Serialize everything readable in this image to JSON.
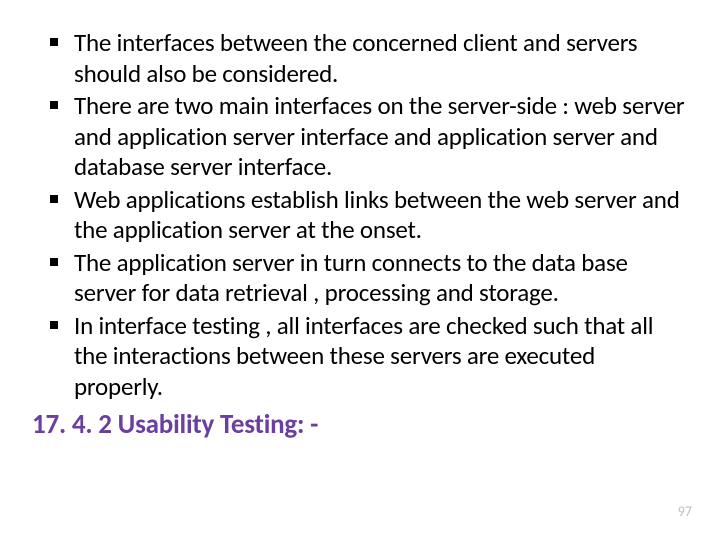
{
  "bullets": [
    "The interfaces between the concerned client and servers should also be considered.",
    "There are two main interfaces on the server-side : web server and application server interface and application server and database server interface.",
    "Web applications establish links between the web server and the application server at the onset.",
    "The application server in turn connects to the data base server for data retrieval , processing and storage.",
    " In interface testing , all interfaces are checked such that all the interactions between these servers are executed properly."
  ],
  "heading": "17. 4. 2 Usability Testing: -",
  "page_number": "97"
}
